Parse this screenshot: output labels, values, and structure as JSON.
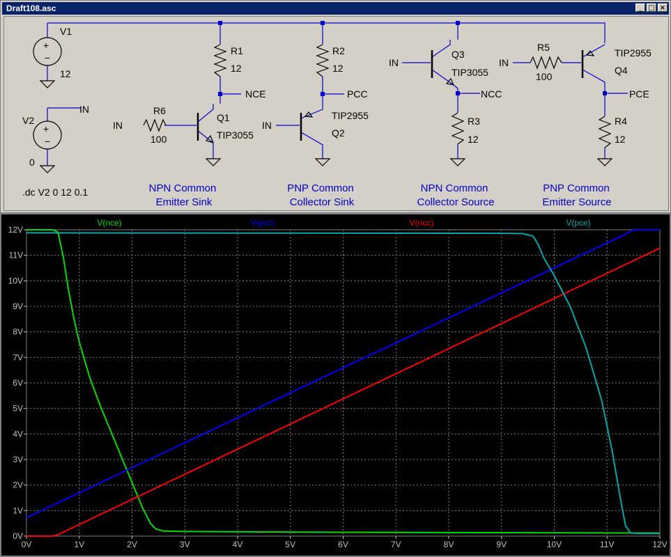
{
  "window": {
    "title": "Draft108.asc",
    "minimize_glyph": "_",
    "maximize_glyph": "□",
    "close_glyph": "×"
  },
  "schematic": {
    "directive": ".dc V2 0 12 0.1",
    "v1": {
      "name": "V1",
      "value": "12"
    },
    "v2": {
      "name": "V2",
      "value": "0",
      "net": "IN"
    },
    "r1": {
      "name": "R1",
      "value": "12"
    },
    "r2": {
      "name": "R2",
      "value": "12"
    },
    "r3": {
      "name": "R3",
      "value": "12"
    },
    "r4": {
      "name": "R4",
      "value": "12"
    },
    "r5": {
      "name": "R5",
      "value": "100"
    },
    "r6": {
      "name": "R6",
      "value": "100"
    },
    "q1": {
      "name": "Q1",
      "model": "TIP3055"
    },
    "q2": {
      "name": "Q2",
      "model": "TIP2955"
    },
    "q3": {
      "name": "Q3",
      "model": "TIP3055"
    },
    "q4": {
      "name": "Q4",
      "model": "TIP2955"
    },
    "nets": {
      "nce": "NCE",
      "pcc": "PCC",
      "ncc": "NCC",
      "pce": "PCE",
      "in": "IN"
    },
    "captions": {
      "c1_line1": "NPN Common",
      "c1_line2": "Emitter Sink",
      "c2_line1": "PNP Common",
      "c2_line2": "Collector Sink",
      "c3_line1": "NPN Common",
      "c3_line2": "Collector Source",
      "c4_line1": "PNP Common",
      "c4_line2": "Emitter Source"
    },
    "caption_color": "#0000cc",
    "wire_color": "#0000cc"
  },
  "chart_data": {
    "type": "line",
    "xlim": [
      0,
      12
    ],
    "ylim": [
      0,
      12
    ],
    "x_ticks": [
      "0V",
      "1V",
      "2V",
      "3V",
      "4V",
      "5V",
      "6V",
      "7V",
      "8V",
      "9V",
      "10V",
      "11V",
      "12V"
    ],
    "y_ticks": [
      "0V",
      "1V",
      "2V",
      "3V",
      "4V",
      "5V",
      "6V",
      "7V",
      "8V",
      "9V",
      "10V",
      "11V",
      "12V"
    ],
    "grid": true,
    "series": [
      {
        "name": "V(nce)",
        "color": "#00dd00",
        "x": [
          0,
          0.5,
          0.6,
          0.7,
          0.8,
          0.9,
          1.0,
          1.2,
          1.4,
          1.6,
          1.8,
          2.0,
          2.2,
          2.35,
          2.45,
          2.6,
          3.0,
          6.0,
          12.0
        ],
        "y": [
          12.0,
          12.0,
          11.9,
          10.9,
          9.6,
          8.5,
          7.6,
          6.2,
          5.1,
          4.1,
          3.1,
          2.1,
          1.1,
          0.5,
          0.28,
          0.2,
          0.18,
          0.15,
          0.12
        ]
      },
      {
        "name": "V(pcc)",
        "color": "#0000ff",
        "x": [
          0,
          11.3,
          11.5,
          12.0
        ],
        "y": [
          0.72,
          11.78,
          12.0,
          12.0
        ]
      },
      {
        "name": "V(ncc)",
        "color": "#ff0000",
        "x": [
          0,
          0.5,
          0.6,
          12.0
        ],
        "y": [
          0.0,
          0.0,
          0.06,
          11.28
        ]
      },
      {
        "name": "V(pce)",
        "color": "#00aaaa",
        "x": [
          0,
          5.0,
          9.0,
          9.4,
          9.6,
          9.7,
          9.8,
          10.0,
          10.3,
          10.6,
          10.9,
          11.1,
          11.25,
          11.35,
          11.45,
          11.6,
          12.0
        ],
        "y": [
          11.88,
          11.87,
          11.86,
          11.85,
          11.75,
          11.4,
          10.9,
          10.2,
          9.0,
          7.4,
          5.3,
          3.3,
          1.5,
          0.4,
          0.12,
          0.1,
          0.1
        ]
      }
    ]
  }
}
